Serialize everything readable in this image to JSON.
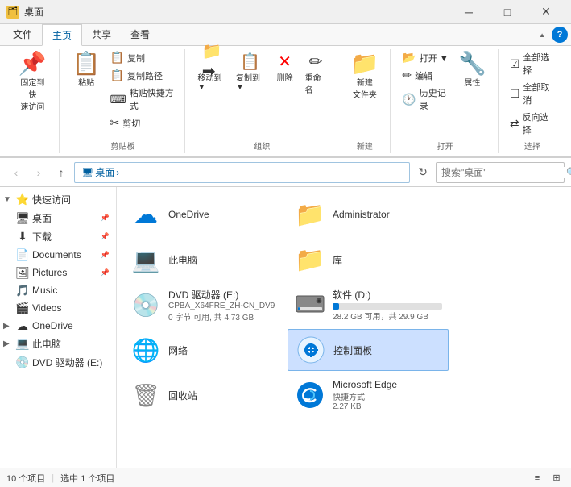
{
  "titleBar": {
    "icon": "🗂",
    "text": "桌面",
    "buttons": {
      "minimize": "─",
      "maximize": "□",
      "close": "✕"
    }
  },
  "ribbon": {
    "tabs": [
      "文件",
      "主页",
      "共享",
      "查看"
    ],
    "activeTab": "主页",
    "groups": [
      {
        "label": "固定到快速访问",
        "buttons": [
          {
            "icon": "📌",
            "label": "固定到快\n速访问"
          }
        ]
      },
      {
        "label": "剪贴板",
        "buttons": [
          {
            "icon": "📋",
            "label": "复制"
          },
          {
            "icon": "📋",
            "label": "粘贴"
          },
          {
            "icon": "✂",
            "label": "剪切"
          }
        ],
        "smallButtons": [
          {
            "icon": "📋",
            "label": "复制路径"
          },
          {
            "icon": "⌨",
            "label": "粘贴快捷方式"
          }
        ]
      },
      {
        "label": "组织",
        "buttons": [
          {
            "icon": "→📁",
            "label": "移动到▼"
          },
          {
            "icon": "📋→",
            "label": "复制到▼"
          },
          {
            "icon": "🗑",
            "label": "删除",
            "color": "red"
          },
          {
            "icon": "✏",
            "label": "重命名"
          }
        ]
      },
      {
        "label": "新建",
        "buttons": [
          {
            "icon": "📁",
            "label": "新建\n文件夹"
          }
        ]
      },
      {
        "label": "打开",
        "buttons": [
          {
            "icon": "📂",
            "label": "打开▼"
          },
          {
            "icon": "🔧",
            "label": "属性"
          }
        ],
        "smallButtons": [
          {
            "icon": "✏",
            "label": "编辑"
          },
          {
            "icon": "🕐",
            "label": "历史记录"
          }
        ]
      },
      {
        "label": "选择",
        "buttons": [
          {
            "icon": "☑",
            "label": "全部选择"
          },
          {
            "icon": "☐",
            "label": "全部取消"
          },
          {
            "icon": "⇄",
            "label": "反向选择"
          }
        ]
      }
    ]
  },
  "addressBar": {
    "navBack": "‹",
    "navForward": "›",
    "navUp": "↑",
    "path": "桌面",
    "pathIcon": "🖥",
    "refresh": "↻",
    "searchPlaceholder": "搜索\"桌面\""
  },
  "sidebar": {
    "items": [
      {
        "id": "quick-access",
        "label": "快速访问",
        "expanded": true,
        "indent": 0,
        "hasExpand": true,
        "icon": "⭐"
      },
      {
        "id": "desktop",
        "label": "桌面",
        "indent": 1,
        "icon": "🖥",
        "pinned": true
      },
      {
        "id": "downloads",
        "label": "下载",
        "indent": 1,
        "icon": "⬇",
        "pinned": true
      },
      {
        "id": "documents",
        "label": "Documents",
        "indent": 1,
        "icon": "📄",
        "pinned": true
      },
      {
        "id": "pictures",
        "label": "Pictures",
        "indent": 1,
        "icon": "🖼",
        "pinned": true
      },
      {
        "id": "music",
        "label": "Music",
        "indent": 1,
        "icon": "🎵"
      },
      {
        "id": "videos",
        "label": "Videos",
        "indent": 1,
        "icon": "🎬"
      },
      {
        "id": "onedrive",
        "label": "OneDrive",
        "indent": 0,
        "icon": "☁",
        "hasExpand": true
      },
      {
        "id": "thispc",
        "label": "此电脑",
        "indent": 0,
        "icon": "💻",
        "hasExpand": true
      },
      {
        "id": "dvd",
        "label": "DVD 驱动器 (E:)",
        "indent": 1,
        "icon": "💿"
      }
    ]
  },
  "content": {
    "items": [
      {
        "id": "onedrive",
        "name": "OneDrive",
        "icon": "☁",
        "iconColor": "#0078d7",
        "detail": ""
      },
      {
        "id": "admin",
        "name": "Administrator",
        "icon": "📁",
        "iconColor": "#f0c040",
        "detail": ""
      },
      {
        "id": "thispc",
        "name": "此电脑",
        "icon": "💻",
        "iconColor": "#555",
        "detail": ""
      },
      {
        "id": "library",
        "name": "库",
        "icon": "📁",
        "iconColor": "#f0a000",
        "detail": ""
      },
      {
        "id": "dvd",
        "name": "DVD 驱动器 (E:)",
        "icon": "💿",
        "iconColor": "#228822",
        "detail": "CPBA_X64FRE_ZH-CN_DV9",
        "detail2": "0 字节 可用, 共 4.73 GB"
      },
      {
        "id": "driveD",
        "name": "软件 (D:)",
        "icon": "💾",
        "iconColor": "#444",
        "detail": "28.2 GB 可用，共 29.9 GB",
        "hasDriveBar": true,
        "driveFill": 6
      },
      {
        "id": "network",
        "name": "网络",
        "icon": "🌐",
        "iconColor": "#0060a0",
        "detail": ""
      },
      {
        "id": "controlpanel",
        "name": "控制面板",
        "icon": "⚙",
        "iconColor": "#0060a0",
        "detail": "",
        "selected": true
      },
      {
        "id": "recycle",
        "name": "回收站",
        "icon": "🗑",
        "iconColor": "#888",
        "detail": ""
      },
      {
        "id": "edge",
        "name": "Microsoft Edge",
        "icon": "🌀",
        "iconColor": "#0078d7",
        "detail": "快捷方式",
        "detail2": "2.27 KB"
      }
    ]
  },
  "statusBar": {
    "itemCount": "10 个项目",
    "selectedCount": "选中 1 个项目",
    "viewList": "≡",
    "viewGrid": "⊞"
  }
}
